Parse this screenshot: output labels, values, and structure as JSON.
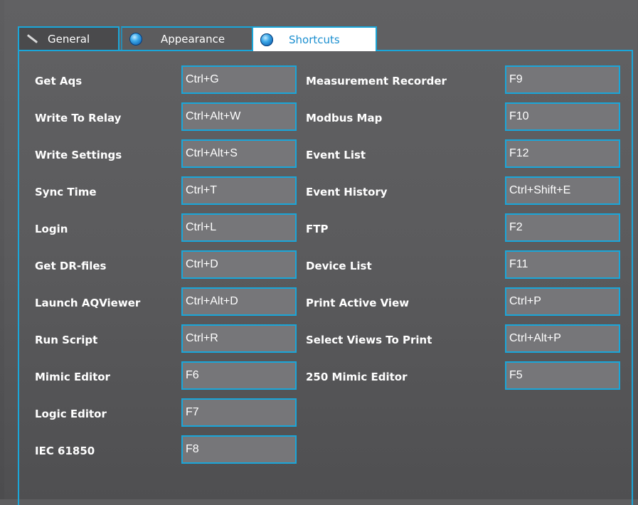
{
  "tabs": {
    "general": "General",
    "appearance": "Appearance",
    "shortcuts": "Shortcuts"
  },
  "colors": {
    "accent": "#1aa6d9",
    "field_bg": "#767679",
    "active_tab_text": "#1b8fd0"
  },
  "shortcuts": {
    "left": [
      {
        "label": "Get Aqs",
        "key": "Ctrl+G"
      },
      {
        "label": "Write To Relay",
        "key": "Ctrl+Alt+W"
      },
      {
        "label": "Write Settings",
        "key": "Ctrl+Alt+S"
      },
      {
        "label": "Sync Time",
        "key": "Ctrl+T"
      },
      {
        "label": "Login",
        "key": "Ctrl+L"
      },
      {
        "label": "Get DR-files",
        "key": "Ctrl+D"
      },
      {
        "label": "Launch AQViewer",
        "key": "Ctrl+Alt+D"
      },
      {
        "label": "Run Script",
        "key": "Ctrl+R"
      },
      {
        "label": "Mimic Editor",
        "key": "F6"
      },
      {
        "label": "Logic Editor",
        "key": "F7"
      },
      {
        "label": "IEC 61850",
        "key": "F8"
      }
    ],
    "right": [
      {
        "label": "Measurement Recorder",
        "key": "F9"
      },
      {
        "label": "Modbus Map",
        "key": "F10"
      },
      {
        "label": "Event List",
        "key": "F12"
      },
      {
        "label": "Event History",
        "key": "Ctrl+Shift+E"
      },
      {
        "label": "FTP",
        "key": "F2"
      },
      {
        "label": "Device List",
        "key": "F11"
      },
      {
        "label": "Print Active View",
        "key": "Ctrl+P"
      },
      {
        "label": "Select Views To Print",
        "key": "Ctrl+Alt+P"
      },
      {
        "label": "250 Mimic Editor",
        "key": "F5"
      }
    ]
  }
}
